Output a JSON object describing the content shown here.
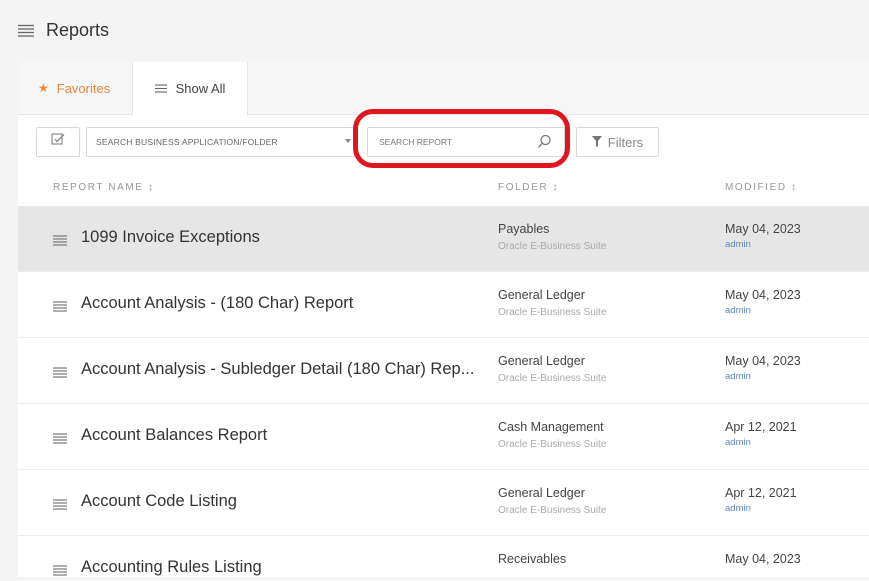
{
  "header": {
    "title": "Reports",
    "menu_icon": "hamburger-list-icon"
  },
  "tabs": [
    {
      "label": "Favorites",
      "icon": "star-icon",
      "active": false
    },
    {
      "label": "Show All",
      "icon": "list-icon",
      "active": true
    }
  ],
  "toolbar": {
    "folder_select_placeholder": "SEARCH BUSINESS APPLICATION/FOLDER",
    "search_placeholder": "SEARCH REPORT",
    "filters_label": "Filters"
  },
  "table": {
    "columns": [
      "REPORT NAME ↕",
      "FOLDER ↕",
      "MODIFIED ↕"
    ],
    "rows": [
      {
        "name": "1099 Invoice Exceptions",
        "folder": "Payables",
        "application": "Oracle E-Business Suite",
        "modified": "May 04, 2023",
        "user": "admin",
        "selected": true
      },
      {
        "name": "Account Analysis - (180 Char) Report",
        "folder": "General Ledger",
        "application": "Oracle E-Business Suite",
        "modified": "May 04, 2023",
        "user": "admin"
      },
      {
        "name": "Account Analysis - Subledger Detail (180 Char) Rep...",
        "folder": "General Ledger",
        "application": "Oracle E-Business Suite",
        "modified": "May 04, 2023",
        "user": "admin"
      },
      {
        "name": "Account Balances Report",
        "folder": "Cash Management",
        "application": "Oracle E-Business Suite",
        "modified": "Apr 12, 2021",
        "user": "admin"
      },
      {
        "name": "Account Code Listing",
        "folder": "General Ledger",
        "application": "Oracle E-Business Suite",
        "modified": "Apr 12, 2021",
        "user": "admin"
      },
      {
        "name": "Accounting Rules Listing",
        "folder": "Receivables",
        "application": "",
        "modified": "May 04, 2023",
        "user": ""
      }
    ]
  },
  "colors": {
    "accent_orange": "#e8863a",
    "highlight_red": "#e0161f",
    "link_blue": "#5b86c4",
    "selected_row": "#e6e6e6"
  }
}
